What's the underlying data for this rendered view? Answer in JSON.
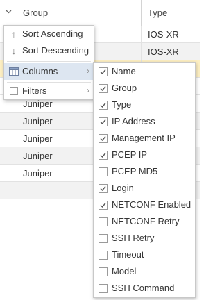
{
  "header": {
    "columns": [
      "Group",
      "Type"
    ]
  },
  "rows": [
    {
      "group": "",
      "type": "IOS-XR",
      "style": "plain"
    },
    {
      "group": "",
      "type": "IOS-XR",
      "style": "alt"
    },
    {
      "group": "",
      "type": "",
      "style": "sel"
    },
    {
      "group": "",
      "type": "",
      "style": "plain"
    },
    {
      "group": "Juniper",
      "type": "",
      "style": "plain"
    },
    {
      "group": "Juniper",
      "type": "",
      "style": "alt"
    },
    {
      "group": "Juniper",
      "type": "",
      "style": "plain"
    },
    {
      "group": "Juniper",
      "type": "",
      "style": "alt"
    },
    {
      "group": "Juniper",
      "type": "",
      "style": "plain"
    },
    {
      "group": "",
      "type": "",
      "style": "alt"
    }
  ],
  "column_menu": {
    "sort_ascending": "Sort Ascending",
    "sort_descending": "Sort Descending",
    "columns": "Columns",
    "filters": "Filters",
    "filters_checked": false
  },
  "columns_submenu": [
    {
      "label": "Name",
      "checked": true
    },
    {
      "label": "Group",
      "checked": true
    },
    {
      "label": "Type",
      "checked": true
    },
    {
      "label": "IP Address",
      "checked": true
    },
    {
      "label": "Management IP",
      "checked": true
    },
    {
      "label": "PCEP IP",
      "checked": true
    },
    {
      "label": "PCEP MD5",
      "checked": false
    },
    {
      "label": "Login",
      "checked": true
    },
    {
      "label": "NETCONF Enabled",
      "checked": true
    },
    {
      "label": "NETCONF Retry",
      "checked": false
    },
    {
      "label": "SSH Retry",
      "checked": false
    },
    {
      "label": "Timeout",
      "checked": false
    },
    {
      "label": "Model",
      "checked": false
    },
    {
      "label": "SSH Command",
      "checked": false
    }
  ],
  "icons": {
    "trigger": "chevron-down-icon",
    "sort_asc": "arrow-up-icon",
    "sort_desc": "arrow-down-icon",
    "columns": "columns-icon",
    "submenu_arrow": "chevron-right-icon",
    "checkbox": "checkmark-icon"
  },
  "colors": {
    "selected_row": "#fdefc3",
    "alt_row": "#f2f2f2",
    "menu_hover": "#dde6f1"
  }
}
